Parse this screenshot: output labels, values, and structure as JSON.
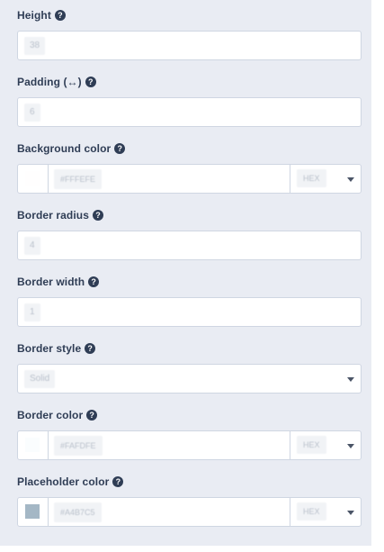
{
  "fields": {
    "height": {
      "label": "Height",
      "value": "38"
    },
    "padding": {
      "label": "Padding (↔)",
      "value": "6"
    },
    "background_color": {
      "label": "Background color",
      "value": "#FFFEFE",
      "format": "HEX",
      "swatch": "#FFFEFE"
    },
    "border_radius": {
      "label": "Border radius",
      "value": "4"
    },
    "border_width": {
      "label": "Border width",
      "value": "1"
    },
    "border_style": {
      "label": "Border style",
      "value": "Solid"
    },
    "border_color": {
      "label": "Border color",
      "value": "#FAFDFE",
      "format": "HEX",
      "swatch": "#FAFDFE"
    },
    "placeholder_color": {
      "label": "Placeholder color",
      "value": "#A4B7C5",
      "format": "HEX",
      "swatch": "#A4B7C5"
    }
  },
  "icons": {
    "help": "question-circle-icon",
    "dropdown": "caret-down-icon"
  },
  "colors": {
    "panel_background": "#e9ecf3",
    "label_text": "#2f3d55",
    "input_border": "#cfd6e2"
  }
}
